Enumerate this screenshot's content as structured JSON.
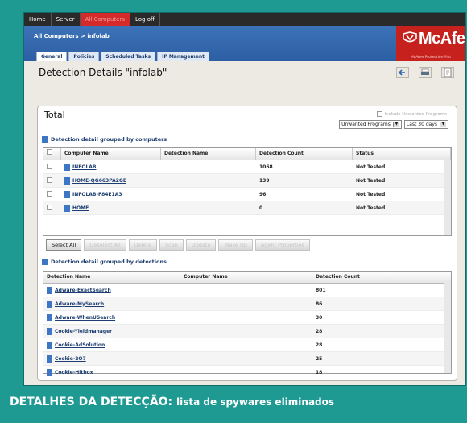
{
  "nav": [
    "Home",
    "Server",
    "All Computers",
    "Log off"
  ],
  "banner": {
    "breadcrumb": "All Computers > infolab",
    "logo": "McAfee",
    "logo_tag": "McAfee ProtectionPilot"
  },
  "tabs": [
    "General",
    "Policies",
    "Scheduled Tasks",
    "IP Management"
  ],
  "page_title": "Detection Details \"infolab\"",
  "panel": {
    "total_label": "Total",
    "include_label": "Include Unwanted Programs",
    "filter_type": "Unwanted Programs",
    "filter_period": "Last 30 days"
  },
  "computers_section": {
    "title": "Detection detail grouped by computers",
    "columns": [
      "Computer Name",
      "Detection Name",
      "Detection Count",
      "Status"
    ],
    "rows": [
      {
        "name": "INFOLAB",
        "detection": "",
        "count": "1068",
        "status": "Not Tested"
      },
      {
        "name": "HOME-QG663PA2GE",
        "detection": "",
        "count": "139",
        "status": "Not Tested"
      },
      {
        "name": "INFOLAB-F84E1A3",
        "detection": "",
        "count": "96",
        "status": "Not Tested"
      },
      {
        "name": "HOME",
        "detection": "",
        "count": "0",
        "status": "Not Tested"
      }
    ]
  },
  "buttons": [
    "Select All",
    "Deselect All",
    "Delete",
    "Scan",
    "Update",
    "Wake Up",
    "Agent Properties"
  ],
  "detections_section": {
    "title": "Detection detail grouped by detections",
    "columns": [
      "Detection Name",
      "Computer Name",
      "Detection Count"
    ],
    "rows": [
      {
        "name": "Adware-ExactSearch",
        "computer": "",
        "count": "801"
      },
      {
        "name": "Adware-MySearch",
        "computer": "",
        "count": "86"
      },
      {
        "name": "Adware-WhenUSearch",
        "computer": "",
        "count": "30"
      },
      {
        "name": "Cookie-Yieldmanager",
        "computer": "",
        "count": "28"
      },
      {
        "name": "Cookie-AdSolution",
        "computer": "",
        "count": "28"
      },
      {
        "name": "Cookie-2O7",
        "computer": "",
        "count": "25"
      },
      {
        "name": "Cookie-Hitbox",
        "computer": "",
        "count": "18"
      }
    ]
  },
  "caption": {
    "lead": "DETALHES DA DETECÇÃO:",
    "rest": "lista de spywares eliminados"
  },
  "colors": {
    "background": "#1f9a93",
    "accent_red": "#c6211d",
    "banner_blue": "#2d5ea3",
    "link_blue": "#1c3d70"
  }
}
